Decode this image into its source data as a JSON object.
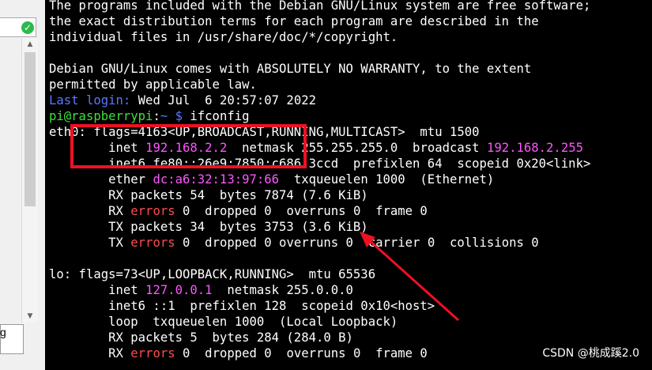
{
  "left_panel": {
    "fragment": "g",
    "status_icon": "check-circle-icon"
  },
  "terminal": {
    "lines": [
      {
        "text": "The programs included with the Debian GNU/Linux system are free software;"
      },
      {
        "text": "the exact distribution terms for each program are described in the"
      },
      {
        "text": "individual files in /usr/share/doc/*/copyright."
      },
      {
        "text": ""
      },
      {
        "text": "Debian GNU/Linux comes with ABSOLUTELY NO WARRANTY, to the extent"
      },
      {
        "text": "permitted by applicable law."
      },
      {
        "label": "Last login:",
        "text": " Wed Jul  6 20:57:07 2022"
      },
      {
        "prompt_user": "pi@raspberrypi",
        "prompt_sep": ":",
        "prompt_path": "~ $",
        "command": " ifconfig"
      },
      {
        "text": "eth0: flags=4163<UP,BROADCAST,RUNNING,MULTICAST>  mtu 1500"
      },
      {
        "pre": "        inet ",
        "ip": "192.168.2.2",
        "mid": "  netmask 255.255.255.0  broadcast ",
        "bcast": "192.168.2.255"
      },
      {
        "text": "        inet6 fe80::26e9:7850:c686:3ccd  prefixlen 64  scopeid 0x20<link>"
      },
      {
        "pre": "        ether ",
        "mac": "dc:a6:32:13:97:66",
        "post": "  txqueuelen 1000  (Ethernet)"
      },
      {
        "text": "        RX packets 54  bytes 7874 (7.6 KiB)"
      },
      {
        "pre": "        RX ",
        "err": "errors",
        "post": " 0  dropped 0  overruns 0  frame 0"
      },
      {
        "text": "        TX packets 34  bytes 3753 (3.6 KiB)"
      },
      {
        "pre": "        TX ",
        "err": "errors",
        "post": " 0  dropped 0 overruns 0  carrier 0  collisions 0"
      },
      {
        "text": ""
      },
      {
        "text": "lo: flags=73<UP,LOOPBACK,RUNNING>  mtu 65536"
      },
      {
        "pre": "        inet ",
        "ip": "127.0.0.1",
        "post": "  netmask 255.0.0.0"
      },
      {
        "text": "        inet6 ::1  prefixlen 128  scopeid 0x10<host>"
      },
      {
        "text": "        loop  txqueuelen 1000  (Local Loopback)"
      },
      {
        "text": "        RX packets 5  bytes 284 (284.0 B)"
      },
      {
        "pre": "        RX ",
        "err": "errors",
        "post": " 0  dropped 0  overruns 0  frame 0"
      }
    ]
  },
  "annotation": {
    "box_color": "#ee1122"
  },
  "watermark": "CSDN @桃成蹊2.0",
  "colors": {
    "background": "#000000",
    "text": "#ffffff",
    "prompt": "#3ce23c",
    "highlight_blue": "#5a78ff",
    "magenta": "#ff55ff",
    "error_red": "#ff4b4b"
  }
}
